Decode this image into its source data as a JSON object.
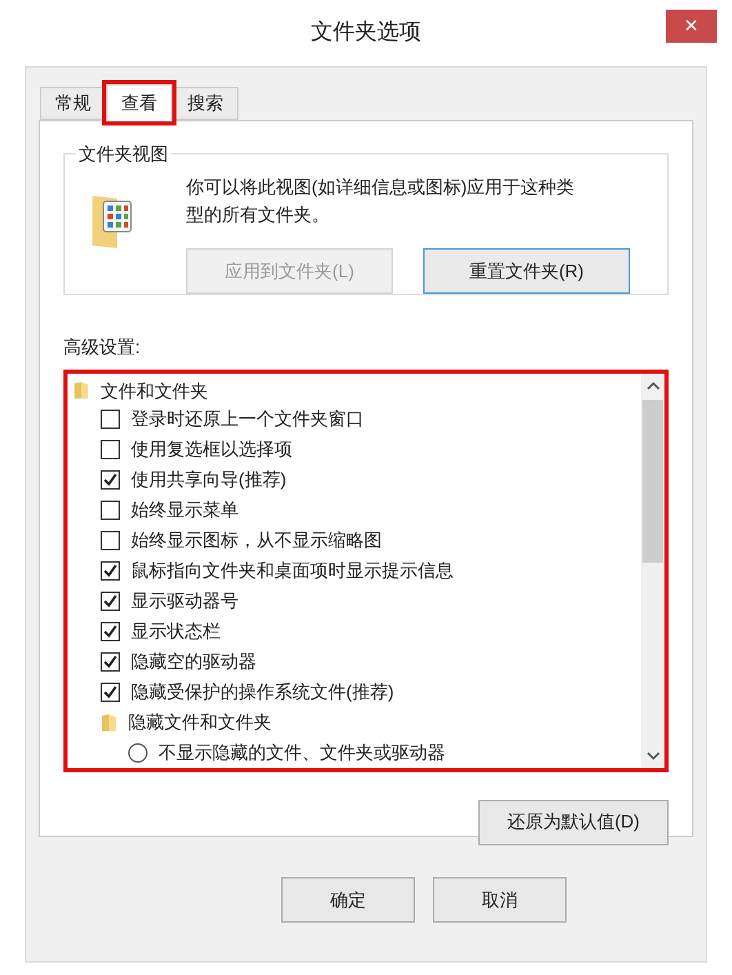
{
  "window": {
    "title": "文件夹选项",
    "close": "✕"
  },
  "tabs": [
    {
      "label": "常规",
      "selected": false,
      "annotated": false
    },
    {
      "label": "查看",
      "selected": true,
      "annotated": true
    },
    {
      "label": "搜索",
      "selected": false,
      "annotated": false
    }
  ],
  "folder_views": {
    "title": "文件夹视图",
    "description": "你可以将此视图(如详细信息或图标)应用于这种类型的所有文件夹。",
    "buttons": [
      {
        "label": "应用到文件夹(L)",
        "disabled": true
      },
      {
        "label": "重置文件夹(R)",
        "disabled": false
      }
    ]
  },
  "advanced": {
    "label": "高级设置:",
    "annotated": true,
    "items": [
      {
        "kind": "folder",
        "label": "文件和文件夹",
        "children": [
          {
            "kind": "checkbox",
            "label": "登录时还原上一个文件夹窗口",
            "checked": false
          },
          {
            "kind": "checkbox",
            "label": "使用复选框以选择项",
            "checked": false
          },
          {
            "kind": "checkbox",
            "label": "使用共享向导(推荐)",
            "checked": true
          },
          {
            "kind": "checkbox",
            "label": "始终显示菜单",
            "checked": false
          },
          {
            "kind": "checkbox",
            "label": "始终显示图标，从不显示缩略图",
            "checked": false
          },
          {
            "kind": "checkbox",
            "label": "鼠标指向文件夹和桌面项时显示提示信息",
            "checked": true
          },
          {
            "kind": "checkbox",
            "label": "显示驱动器号",
            "checked": true
          },
          {
            "kind": "checkbox",
            "label": "显示状态栏",
            "checked": true
          },
          {
            "kind": "checkbox",
            "label": "隐藏空的驱动器",
            "checked": true
          },
          {
            "kind": "checkbox",
            "label": "隐藏受保护的操作系统文件(推荐)",
            "checked": true
          },
          {
            "kind": "folder",
            "label": "隐藏文件和文件夹",
            "children": [
              {
                "kind": "radio",
                "label": "不显示隐藏的文件、文件夹或驱动器",
                "selected": false
              }
            ]
          }
        ]
      }
    ]
  },
  "restore_button": "还原为默认值(D)",
  "buttons": [
    "确定",
    "取消"
  ]
}
